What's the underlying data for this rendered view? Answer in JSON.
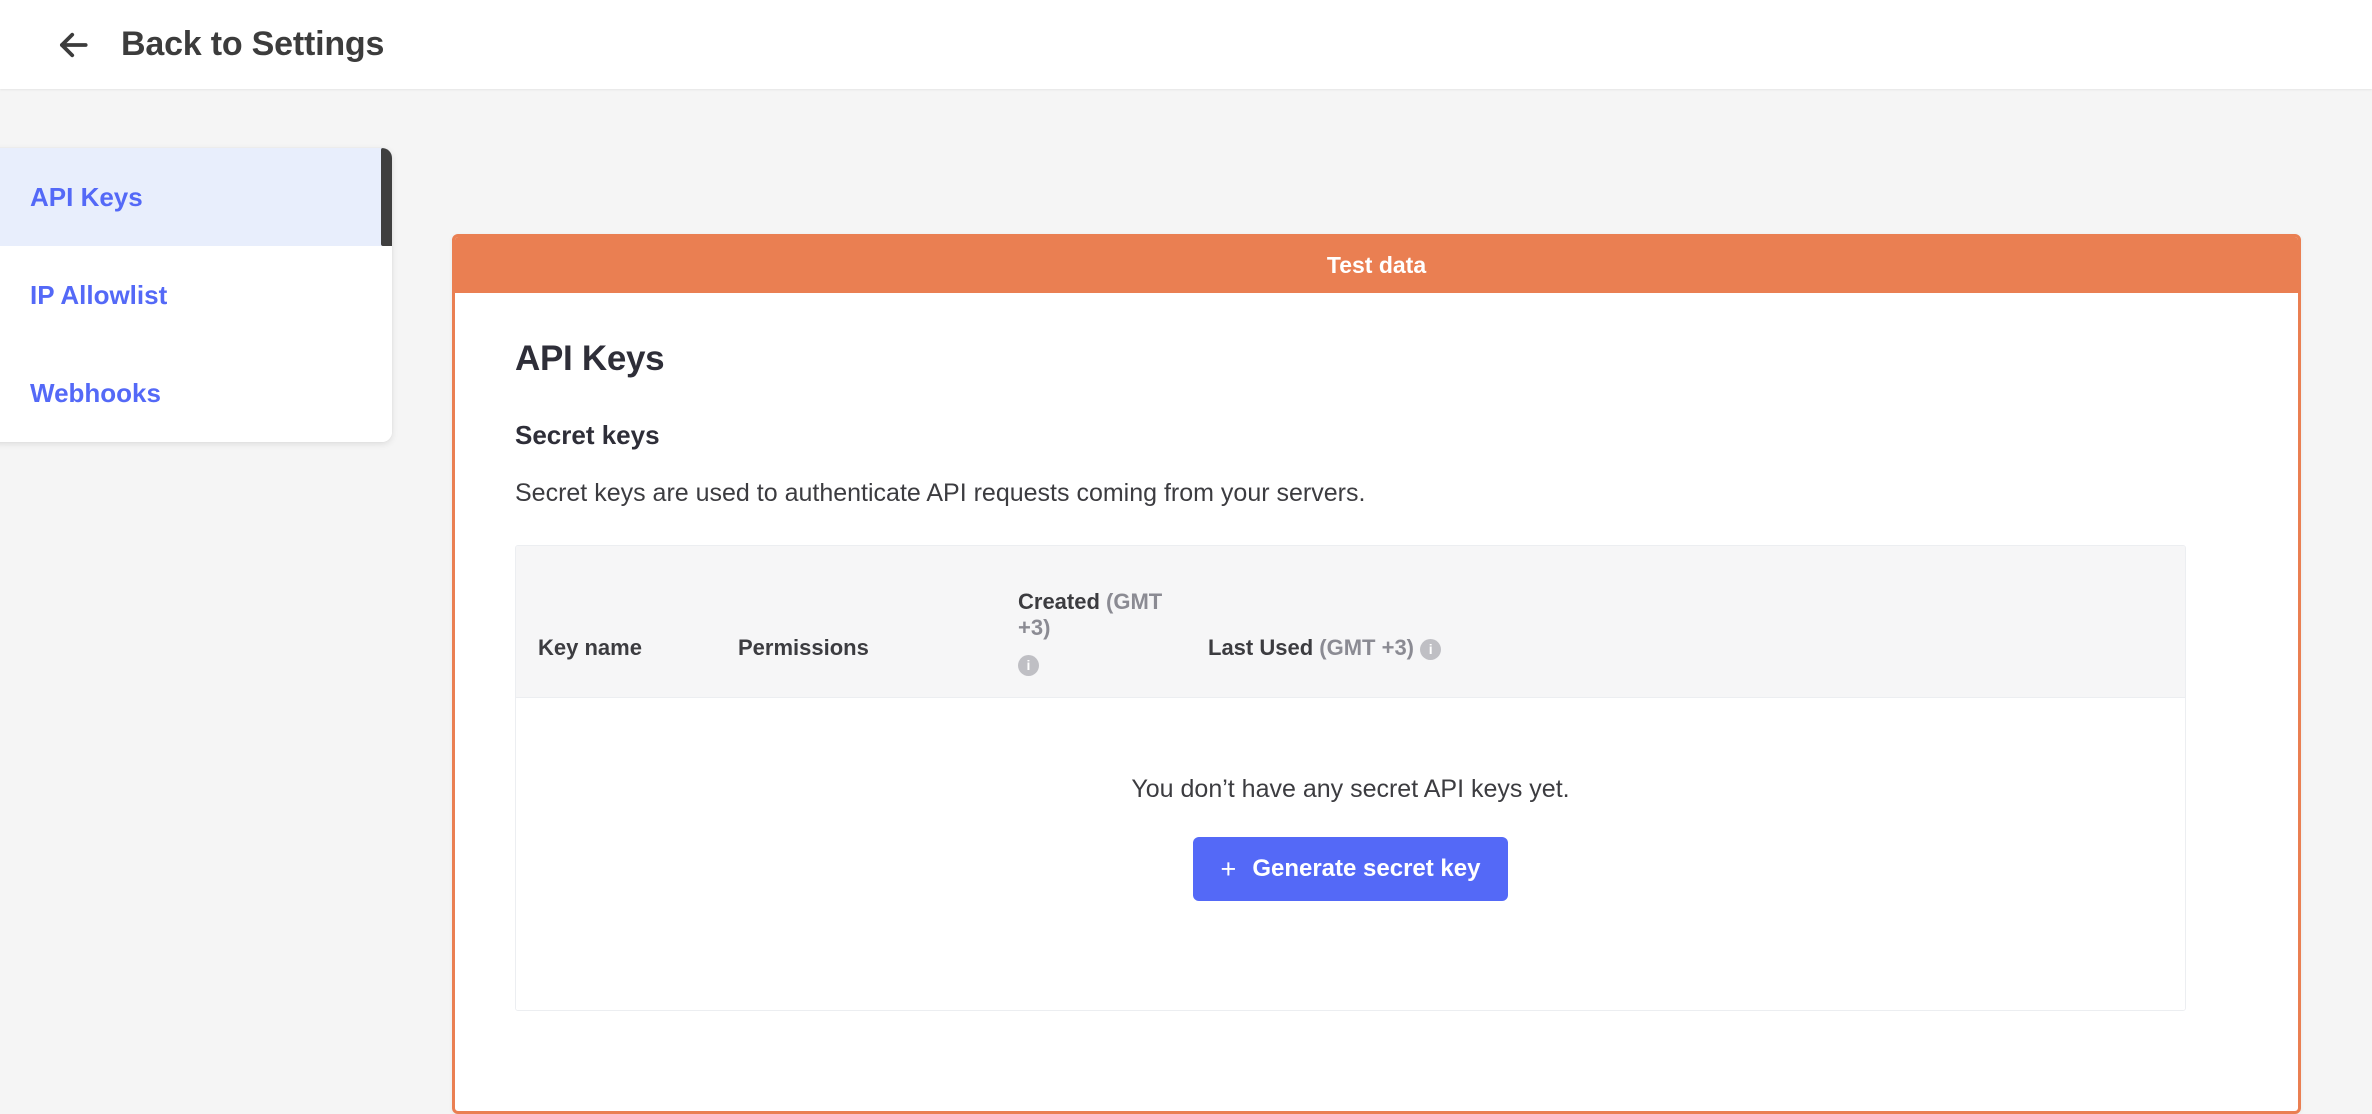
{
  "topbar": {
    "back_icon": "arrow-left-icon",
    "title": "Back to Settings"
  },
  "sidebar": {
    "items": [
      {
        "label": "API Keys",
        "active": true
      },
      {
        "label": "IP Allowlist",
        "active": false
      },
      {
        "label": "Webhooks",
        "active": false
      }
    ]
  },
  "main": {
    "banner": {
      "label": "Test data",
      "color": "#ea7f52"
    },
    "page_title": "API Keys",
    "section": {
      "title": "Secret keys",
      "description": "Secret keys are used to authenticate API requests coming from your servers."
    },
    "table": {
      "columns": {
        "key_name": "Key name",
        "permissions": "Permissions",
        "created": "Created",
        "created_tz": "(GMT +3)",
        "created_info_icon": "info-icon",
        "last_used": "Last Used",
        "last_used_tz": "(GMT +3)",
        "last_used_info_icon": "info-icon"
      },
      "rows": [],
      "empty_state": {
        "message": "You don’t have any secret API keys yet.",
        "button_label": "Generate secret key",
        "button_icon": "plus-icon",
        "button_color": "#5469f7"
      }
    }
  }
}
